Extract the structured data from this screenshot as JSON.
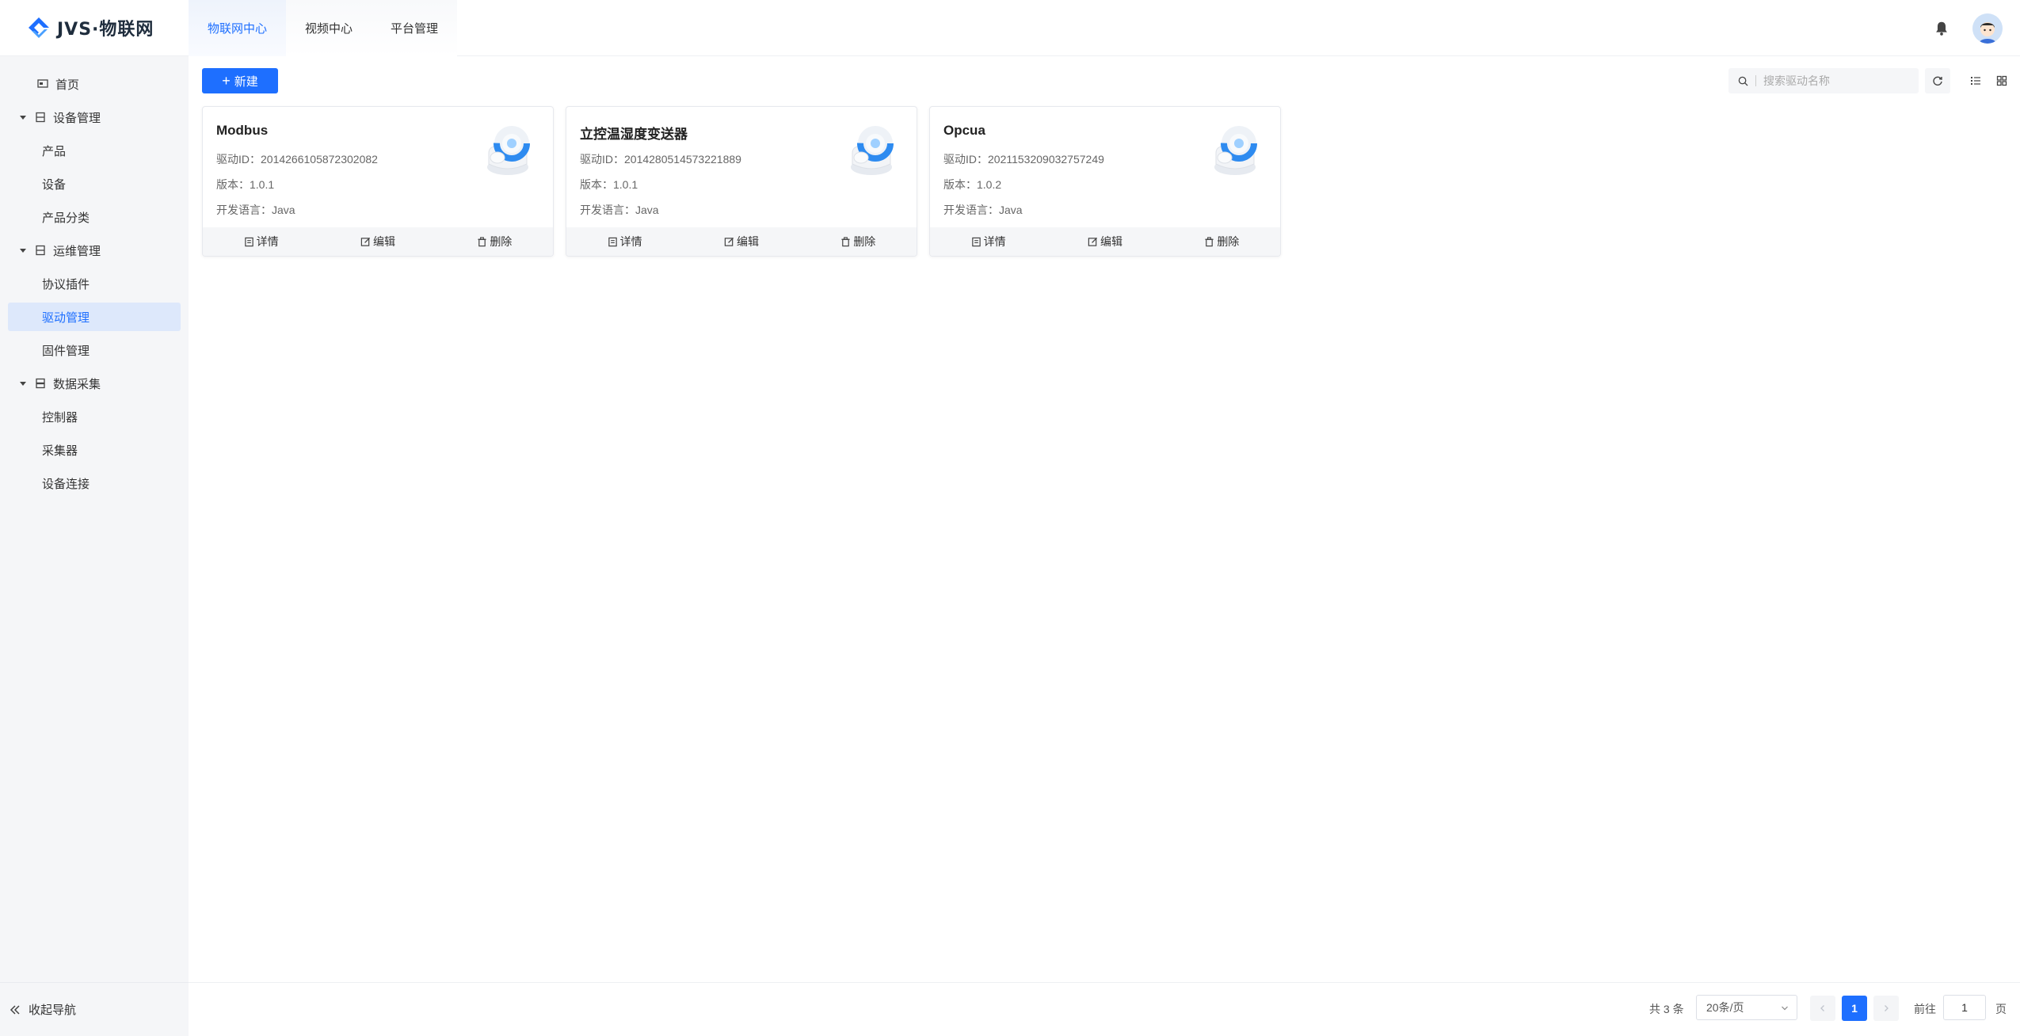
{
  "app": {
    "logo_text": "JVS·物联网",
    "top_tabs": [
      {
        "label": "物联网中心",
        "active": true
      },
      {
        "label": "视频中心",
        "active": false
      },
      {
        "label": "平台管理",
        "active": false
      }
    ]
  },
  "sidebar": {
    "items": [
      {
        "label": "首页",
        "level": "top",
        "icon": "home-icon"
      },
      {
        "label": "设备管理",
        "level": "group",
        "icon": "device-icon"
      },
      {
        "label": "产品",
        "level": "sub"
      },
      {
        "label": "设备",
        "level": "sub"
      },
      {
        "label": "产品分类",
        "level": "sub"
      },
      {
        "label": "运维管理",
        "level": "group",
        "icon": "ops-icon"
      },
      {
        "label": "协议插件",
        "level": "sub"
      },
      {
        "label": "驱动管理",
        "level": "sub",
        "active": true
      },
      {
        "label": "固件管理",
        "level": "sub"
      },
      {
        "label": "数据采集",
        "level": "group",
        "icon": "data-icon"
      },
      {
        "label": "控制器",
        "level": "sub"
      },
      {
        "label": "采集器",
        "level": "sub"
      },
      {
        "label": "设备连接",
        "level": "sub"
      }
    ],
    "collapse_label": "收起导航"
  },
  "toolbar": {
    "new_label": "新建",
    "search_placeholder": "搜索驱动名称"
  },
  "cards": [
    {
      "title": "Modbus",
      "driver_id": "驱动ID：2014266105872302082",
      "version": "版本：1.0.1",
      "language": "开发语言：Java"
    },
    {
      "title": "立控温湿度变送器",
      "driver_id": "驱动ID：2014280514573221889",
      "version": "版本：1.0.1",
      "language": "开发语言：Java"
    },
    {
      "title": "Opcua",
      "driver_id": "驱动ID：2021153209032757249",
      "version": "版本：1.0.2",
      "language": "开发语言：Java"
    }
  ],
  "card_actions": {
    "detail": "详情",
    "edit": "编辑",
    "delete": "删除"
  },
  "pagination": {
    "total": "共 3 条",
    "page_size": "20条/页",
    "current_page": "1",
    "goto_label": "前往",
    "goto_value": "1",
    "page_unit": "页"
  },
  "colors": {
    "accent": "#1e6fff",
    "sidebar_bg": "#f5f6f8",
    "active_nav_bg": "#dde8fb"
  }
}
